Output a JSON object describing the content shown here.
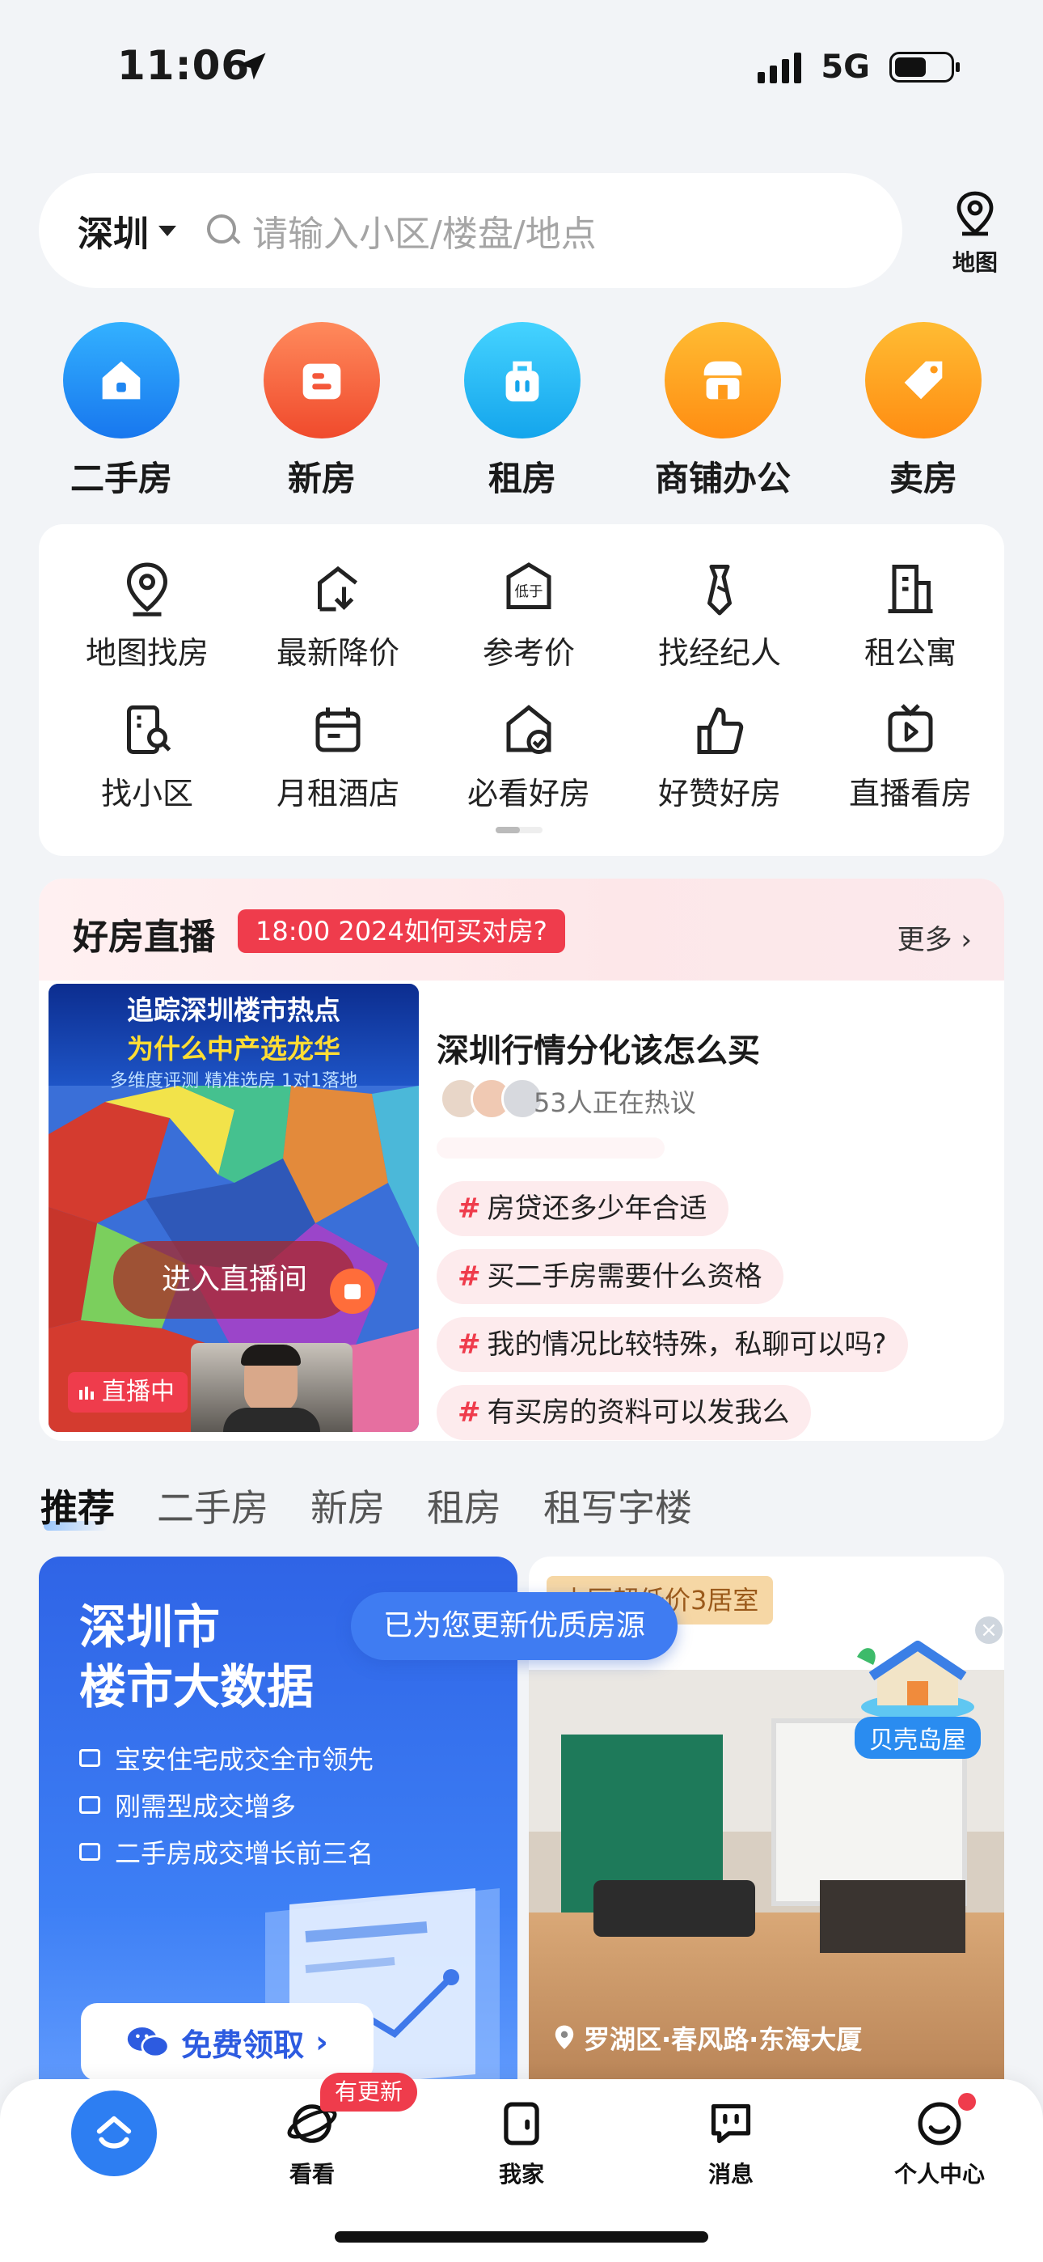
{
  "status": {
    "time": "11:06",
    "network": "5G"
  },
  "search": {
    "city": "深圳",
    "placeholder": "请输入小区/楼盘/地点",
    "map_label": "地图"
  },
  "categories": [
    {
      "label": "二手房",
      "icon": "house-icon",
      "color": "#1a8df0"
    },
    {
      "label": "新房",
      "icon": "new-building-icon",
      "color": "#f4573a"
    },
    {
      "label": "租房",
      "icon": "rent-bag-icon",
      "color": "#1cb2f0"
    },
    {
      "label": "商铺办公",
      "icon": "shop-icon",
      "color": "#ff9a1a"
    },
    {
      "label": "卖房",
      "icon": "sale-tag-icon",
      "color": "#ff9a1a"
    }
  ],
  "tools": [
    {
      "label": "地图找房"
    },
    {
      "label": "最新降价"
    },
    {
      "label": "参考价",
      "icon_text": "低于"
    },
    {
      "label": "找经纪人"
    },
    {
      "label": "租公寓"
    },
    {
      "label": "找小区"
    },
    {
      "label": "月租酒店"
    },
    {
      "label": "必看好房"
    },
    {
      "label": "好赞好房"
    },
    {
      "label": "直播看房"
    }
  ],
  "live": {
    "title": "好房直播",
    "badge": "18:00 2024如何买对房?",
    "more": "更多",
    "video_title_1": "追踪深圳楼市热点",
    "video_title_2": "为什么中产选龙华",
    "video_subtitle": "多维度评测  精准选房  1对1落地",
    "enter": "进入直播间",
    "on_air": "直播中",
    "topic": "深圳行情分化该怎么买",
    "hot": "53人正在热议",
    "questions": [
      "房贷还多少年合适",
      "买二手房需要什么资格",
      "我的情况比较特殊，私聊可以吗?",
      "有买房的资料可以发我么"
    ]
  },
  "feed_tabs": [
    "推荐",
    "二手房",
    "新房",
    "租房",
    "租写字楼"
  ],
  "big_data": {
    "title_1": "深圳市",
    "title_2": "楼市大数据",
    "items": [
      "宝安住宅成交全市领先",
      "刚需型成交增多",
      "二手房成交增长前三名"
    ],
    "button": "免费领取"
  },
  "listing": {
    "tag": "本区超低价3居室",
    "location": "罗湖区·春风路·东海大厦"
  },
  "toast": "已为您更新优质房源",
  "island": {
    "label": "贝壳岛屋"
  },
  "tabbar": {
    "look": "看看",
    "update_badge": "有更新",
    "myhome": "我家",
    "messages": "消息",
    "profile": "个人中心"
  }
}
